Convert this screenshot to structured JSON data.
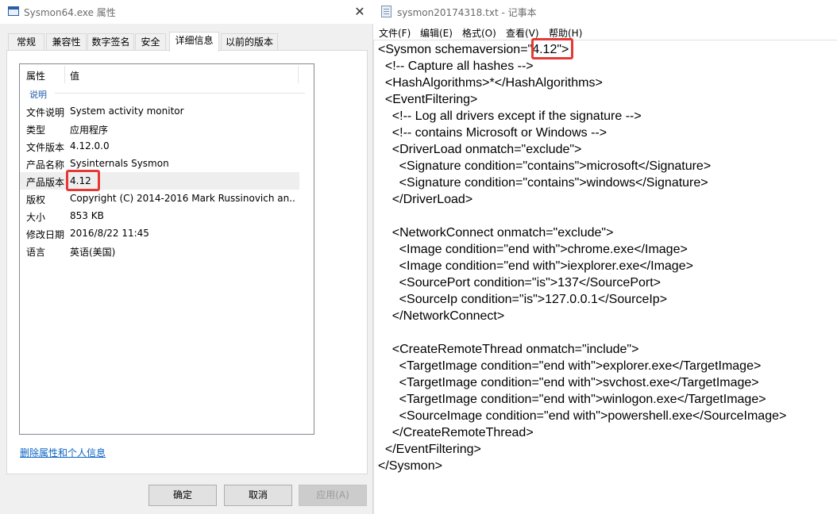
{
  "props_window": {
    "title": "Sysmon64.exe 属性",
    "close_glyph": "✕",
    "tabs": [
      "常规",
      "兼容性",
      "数字签名",
      "安全",
      "详细信息",
      "以前的版本"
    ],
    "active_tab": "详细信息",
    "list": {
      "col_property": "属性",
      "col_value": "值",
      "group": "说明",
      "rows": [
        {
          "k": "文件说明",
          "v": "System activity monitor"
        },
        {
          "k": "类型",
          "v": "应用程序"
        },
        {
          "k": "文件版本",
          "v": "4.12.0.0"
        },
        {
          "k": "产品名称",
          "v": "Sysinternals Sysmon"
        },
        {
          "k": "产品版本",
          "v": "4.12"
        },
        {
          "k": "版权",
          "v": "Copyright (C) 2014-2016 Mark Russinovich an..."
        },
        {
          "k": "大小",
          "v": "853 KB"
        },
        {
          "k": "修改日期",
          "v": "2016/8/22 11:45"
        },
        {
          "k": "语言",
          "v": "英语(美国)"
        }
      ]
    },
    "remove_link": "删除属性和个人信息",
    "buttons": {
      "ok": "确定",
      "cancel": "取消",
      "apply": "应用(A)"
    }
  },
  "notepad": {
    "title": "sysmon20174318.txt - 记事本",
    "menu": [
      "文件(F)",
      "编辑(E)",
      "格式(O)",
      "查看(V)",
      "帮助(H)"
    ],
    "lines": [
      "<Sysmon schemaversion=\"4.12\">",
      "  <!-- Capture all hashes -->",
      "  <HashAlgorithms>*</HashAlgorithms>",
      "  <EventFiltering>",
      "    <!-- Log all drivers except if the signature -->",
      "    <!-- contains Microsoft or Windows -->",
      "    <DriverLoad onmatch=\"exclude\">",
      "      <Signature condition=\"contains\">microsoft</Signature>",
      "      <Signature condition=\"contains\">windows</Signature>",
      "    </DriverLoad>",
      "",
      "    <NetworkConnect onmatch=\"exclude\">",
      "      <Image condition=\"end with\">chrome.exe</Image>",
      "      <Image condition=\"end with\">iexplorer.exe</Image>",
      "      <SourcePort condition=\"is\">137</SourcePort>",
      "      <SourceIp condition=\"is\">127.0.0.1</SourceIp>",
      "    </NetworkConnect>",
      "",
      "    <CreateRemoteThread onmatch=\"include\">",
      "      <TargetImage condition=\"end with\">explorer.exe</TargetImage>",
      "      <TargetImage condition=\"end with\">svchost.exe</TargetImage>",
      "      <TargetImage condition=\"end with\">winlogon.exe</TargetImage>",
      "      <SourceImage condition=\"end with\">powershell.exe</SourceImage>",
      "    </CreateRemoteThread>",
      "  </EventFiltering>",
      "</Sysmon>"
    ]
  },
  "colors": {
    "highlight_box": "#e53935",
    "link": "#0b63c4"
  }
}
